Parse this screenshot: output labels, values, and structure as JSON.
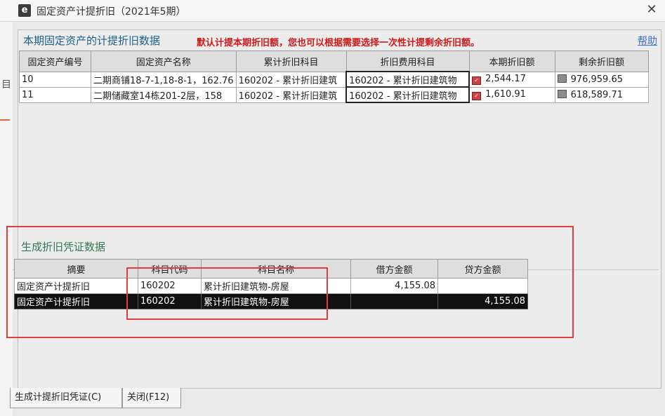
{
  "window": {
    "title": "固定资产计提折旧（2021年5期）",
    "app_icon": "e",
    "close_glyph": "✕",
    "bg_edge_text": "目"
  },
  "upper": {
    "title": "本期固定资产的计提折旧数据",
    "note": "默认计提本期折旧额，您也可以根据需要选择一次性计提剩余折旧额。",
    "help": "帮助",
    "columns": [
      "固定资产编号",
      "固定资产名称",
      "累计折旧科目",
      "折旧费用科目",
      "本期折旧额",
      "剩余折旧额"
    ],
    "rows": [
      {
        "code": "10",
        "name": "二期商铺18-7-1,18-8-1，162.76",
        "accum": "160202 - 累计折旧建筑",
        "expense": "160202 - 累计折旧建筑物",
        "current": "2,544.17",
        "remaining": "976,959.65"
      },
      {
        "code": "11",
        "name": "二期储藏室14栋201-2层，158",
        "accum": "160202 - 累计折旧建筑",
        "expense": "160202 - 累计折旧建筑物",
        "current": "1,610.91",
        "remaining": "618,589.71"
      }
    ]
  },
  "lower": {
    "title": "生成折旧凭证数据",
    "columns": [
      "摘要",
      "科目代码",
      "科目名称",
      "借方金额",
      "贷方金额"
    ],
    "rows": [
      {
        "summary": "固定资产计提折旧",
        "code": "160202",
        "name": "累计折旧建筑物-房屋",
        "debit": "4,155.08",
        "credit": ""
      },
      {
        "summary": "固定资产计提折旧",
        "code": "160202",
        "name": "累计折旧建筑物-房屋",
        "debit": "",
        "credit": "4,155.08"
      }
    ]
  },
  "tabs": {
    "generate": "生成计提折旧凭证(C)",
    "close": "关闭(F12)"
  },
  "colors": {
    "annotation": "#e23d3d",
    "selected_row": "#111111",
    "note": "#d01818"
  }
}
